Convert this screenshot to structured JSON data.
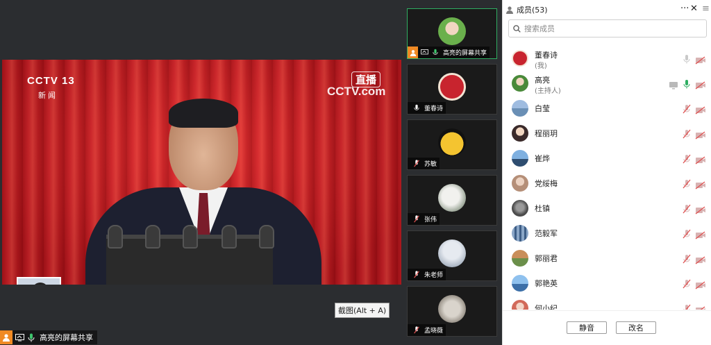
{
  "stage": {
    "share_label": "高亮的屏幕共享",
    "tooltip": "截图(Alt + A)",
    "broadcast": {
      "channel_logo": "CCTV 13",
      "channel_sub": "新闻",
      "live_badge": "直播",
      "site_logo": "CCTV.com"
    }
  },
  "thumbnails": [
    {
      "name": "高亮的屏幕共享",
      "mic": "on",
      "screen_share": true,
      "host": true,
      "avatar": "child-portrait",
      "active": true
    },
    {
      "name": "董春诗",
      "mic": "on",
      "avatar": "red-seal"
    },
    {
      "name": "苏敏",
      "mic": "off",
      "avatar": "yellow-cat"
    },
    {
      "name": "张伟",
      "mic": "off",
      "avatar": "white-rock"
    },
    {
      "name": "朱老师",
      "mic": "off",
      "avatar": "snow-scene"
    },
    {
      "name": "孟晓薇",
      "mic": "off",
      "avatar": "pebbles"
    }
  ],
  "panel": {
    "title": "成员(53)",
    "more": "···",
    "close": "✕",
    "search_placeholder": "搜索成员",
    "members": [
      {
        "name": "董春诗",
        "role": "(我)",
        "mic": "idle",
        "cam": "off",
        "avatar_color": "#c8242e"
      },
      {
        "name": "高亮",
        "role": "(主持人)",
        "mic": "on",
        "cam": "off",
        "screen": true,
        "avatar_color": "#4a8a3a"
      },
      {
        "name": "白莹",
        "mic": "off",
        "cam": "off",
        "avatar_color": "#6a8fb5"
      },
      {
        "name": "程丽玥",
        "mic": "off",
        "cam": "off",
        "avatar_color": "#d9b3a8"
      },
      {
        "name": "崔烨",
        "mic": "off",
        "cam": "off",
        "avatar_color": "#3f6f9c"
      },
      {
        "name": "党绥梅",
        "mic": "off",
        "cam": "off",
        "avatar_color": "#b58f78"
      },
      {
        "name": "杜镇",
        "mic": "off",
        "cam": "off",
        "avatar_color": "#5b5b5b"
      },
      {
        "name": "范毅军",
        "mic": "off",
        "cam": "off",
        "avatar_color": "#8aa6c7"
      },
      {
        "name": "郭丽君",
        "mic": "off",
        "cam": "off",
        "avatar_color": "#c98e5a"
      },
      {
        "name": "郭艳英",
        "mic": "off",
        "cam": "off",
        "avatar_color": "#5f92c9"
      },
      {
        "name": "何小纪",
        "mic": "off",
        "cam": "off",
        "avatar_color": "#d26a5a"
      }
    ],
    "buttons": {
      "mute": "静音",
      "rename": "改名"
    }
  },
  "colors": {
    "accent_green": "#2fae62",
    "host_orange": "#f08a24",
    "muted_red": "#e05050",
    "stage_bg": "#2b2d30"
  }
}
